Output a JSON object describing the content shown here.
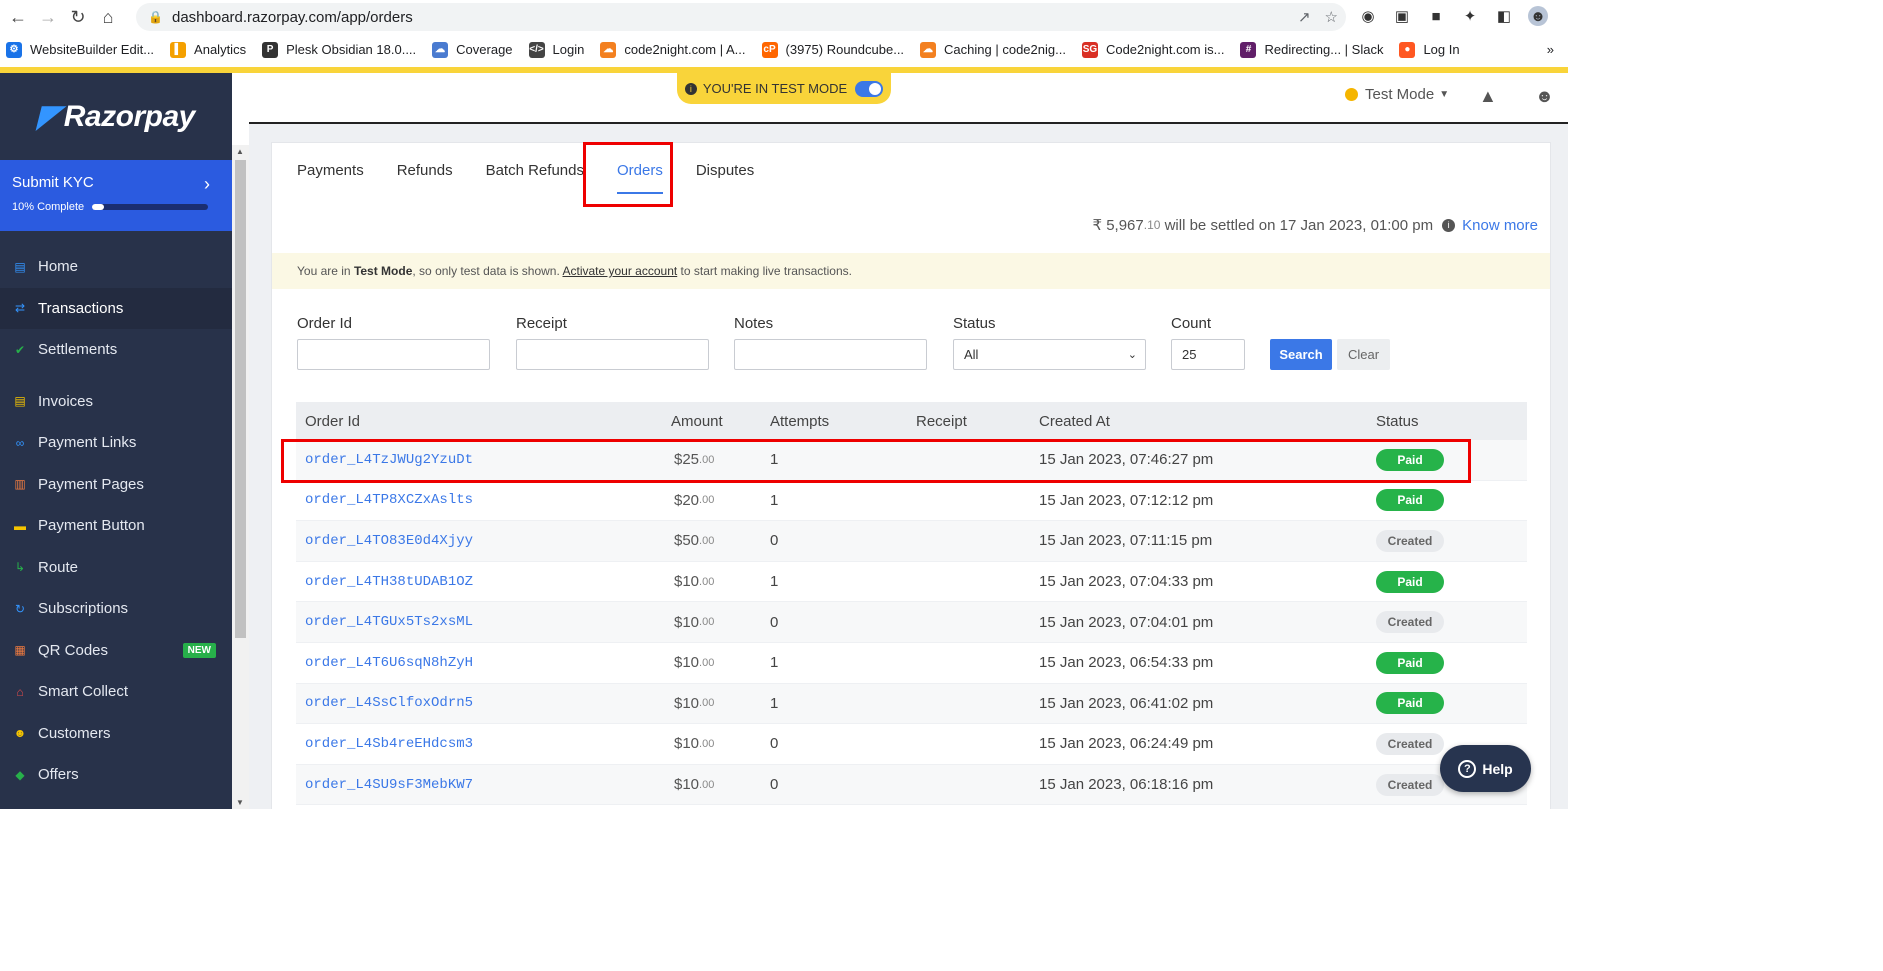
{
  "browser": {
    "url": "dashboard.razorpay.com/app/orders",
    "bookmarks": [
      {
        "label": "WebsiteBuilder Edit...",
        "color": "#1a73e8",
        "glyph": "⚙"
      },
      {
        "label": "Analytics",
        "color": "#f4a000",
        "glyph": "▌"
      },
      {
        "label": "Plesk Obsidian 18.0....",
        "color": "#333333",
        "glyph": "P"
      },
      {
        "label": "Coverage",
        "color": "#4a7bd0",
        "glyph": "☁"
      },
      {
        "label": "Login",
        "color": "#444444",
        "glyph": "</>"
      },
      {
        "label": "code2night.com | A...",
        "color": "#f38020",
        "glyph": "☁"
      },
      {
        "label": "(3975) Roundcube...",
        "color": "#ff6600",
        "glyph": "cP"
      },
      {
        "label": "Caching | code2nig...",
        "color": "#f38020",
        "glyph": "☁"
      },
      {
        "label": "Code2night.com is...",
        "color": "#d93025",
        "glyph": "SG"
      },
      {
        "label": "Redirecting... | Slack",
        "color": "#611f69",
        "glyph": "#"
      },
      {
        "label": "Log In",
        "color": "#ff5722",
        "glyph": "●"
      }
    ],
    "more_glyph": "»"
  },
  "header": {
    "test_banner": "YOU'RE IN TEST MODE",
    "mode_label": "Test Mode"
  },
  "sidebar": {
    "logo_text": "Razorpay",
    "kyc_title": "Submit KYC",
    "kyc_progress_label": "10% Complete",
    "kyc_progress": 0.1,
    "items": [
      {
        "label": "Home",
        "icon": "chart-icon",
        "color": "#3395ff",
        "glyph": "▤"
      },
      {
        "label": "Transactions",
        "icon": "swap-icon",
        "color": "#3395ff",
        "glyph": "⇄",
        "active": true
      },
      {
        "label": "Settlements",
        "icon": "check-icon",
        "color": "#27b04a",
        "glyph": "✔"
      },
      {
        "label": "Invoices",
        "icon": "invoice-icon",
        "color": "#f5c400",
        "glyph": "▤"
      },
      {
        "label": "Payment Links",
        "icon": "link-icon",
        "color": "#3395ff",
        "glyph": "∞"
      },
      {
        "label": "Payment Pages",
        "icon": "page-icon",
        "color": "#f07b3f",
        "glyph": "▥"
      },
      {
        "label": "Payment Button",
        "icon": "button-icon",
        "color": "#f5c400",
        "glyph": "▬"
      },
      {
        "label": "Route",
        "icon": "route-icon",
        "color": "#27b04a",
        "glyph": "↳"
      },
      {
        "label": "Subscriptions",
        "icon": "refresh-icon",
        "color": "#3395ff",
        "glyph": "↻"
      },
      {
        "label": "QR Codes",
        "icon": "qr-icon",
        "color": "#f07b3f",
        "glyph": "▦",
        "badge": "NEW"
      },
      {
        "label": "Smart Collect",
        "icon": "bank-icon",
        "color": "#e04b4b",
        "glyph": "⌂"
      },
      {
        "label": "Customers",
        "icon": "users-icon",
        "color": "#f5c400",
        "glyph": "☻"
      },
      {
        "label": "Offers",
        "icon": "tag-icon",
        "color": "#27b04a",
        "glyph": "◆"
      }
    ]
  },
  "main": {
    "tabs": [
      "Payments",
      "Refunds",
      "Batch Refunds",
      "Orders",
      "Disputes"
    ],
    "active_tab": "Orders",
    "settlement": {
      "currency": "₹",
      "amount_int": "5,967",
      "amount_dec": ".10",
      "text": "will be settled on",
      "date": "17 Jan 2023, 01:00 pm",
      "link": "Know more"
    },
    "notice": {
      "pre": "You are in ",
      "bold": "Test Mode",
      "mid": ", so only test data is shown. ",
      "link": "Activate your account",
      "post": " to start making live transactions."
    },
    "filters": {
      "order_id_label": "Order Id",
      "receipt_label": "Receipt",
      "notes_label": "Notes",
      "status_label": "Status",
      "status_value": "All",
      "count_label": "Count",
      "count_value": "25",
      "search": "Search",
      "clear": "Clear"
    },
    "table": {
      "headers": [
        "Order Id",
        "Amount",
        "Attempts",
        "Receipt",
        "Created At",
        "Status"
      ],
      "rows": [
        {
          "id": "order_L4TzJWUg2YzuDt",
          "amount": "25",
          "dec": ".00",
          "attempts": "1",
          "created": "15 Jan 2023, 07:46:27 pm",
          "status": "Paid"
        },
        {
          "id": "order_L4TP8XCZxAslts",
          "amount": "20",
          "dec": ".00",
          "attempts": "1",
          "created": "15 Jan 2023, 07:12:12 pm",
          "status": "Paid"
        },
        {
          "id": "order_L4TO83E0d4Xjyy",
          "amount": "50",
          "dec": ".00",
          "attempts": "0",
          "created": "15 Jan 2023, 07:11:15 pm",
          "status": "Created"
        },
        {
          "id": "order_L4TH38tUDAB1OZ",
          "amount": "10",
          "dec": ".00",
          "attempts": "1",
          "created": "15 Jan 2023, 07:04:33 pm",
          "status": "Paid"
        },
        {
          "id": "order_L4TGUx5Ts2xsML",
          "amount": "10",
          "dec": ".00",
          "attempts": "0",
          "created": "15 Jan 2023, 07:04:01 pm",
          "status": "Created"
        },
        {
          "id": "order_L4T6U6sqN8hZyH",
          "amount": "10",
          "dec": ".00",
          "attempts": "1",
          "created": "15 Jan 2023, 06:54:33 pm",
          "status": "Paid"
        },
        {
          "id": "order_L4SsClfoxOdrn5",
          "amount": "10",
          "dec": ".00",
          "attempts": "1",
          "created": "15 Jan 2023, 06:41:02 pm",
          "status": "Paid"
        },
        {
          "id": "order_L4Sb4reEHdcsm3",
          "amount": "10",
          "dec": ".00",
          "attempts": "0",
          "created": "15 Jan 2023, 06:24:49 pm",
          "status": "Created"
        },
        {
          "id": "order_L4SU9sF3MebKW7",
          "amount": "10",
          "dec": ".00",
          "attempts": "0",
          "created": "15 Jan 2023, 06:18:16 pm",
          "status": "Created"
        }
      ],
      "currency": "$"
    },
    "help_label": "Help"
  }
}
